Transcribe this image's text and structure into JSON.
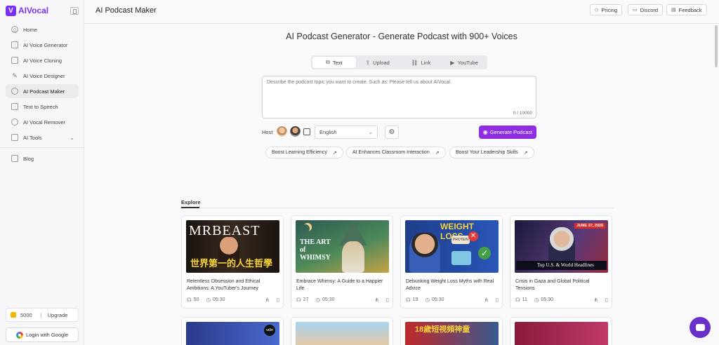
{
  "brand": {
    "name": "AIVocal",
    "logo_letter": "V"
  },
  "sidebar": {
    "items": [
      {
        "label": "Home",
        "icon": "home-icon"
      },
      {
        "label": "AI Voice Generator",
        "icon": "document-icon"
      },
      {
        "label": "AI Voice Cloning",
        "icon": "document-edit-icon"
      },
      {
        "label": "AI Voice Designer",
        "icon": "magic-wand-icon"
      },
      {
        "label": "AI Podcast Maker",
        "icon": "podcast-icon"
      },
      {
        "label": "Text to Speech",
        "icon": "text-icon"
      },
      {
        "label": "AI Vocal Remover",
        "icon": "vocal-remover-icon"
      },
      {
        "label": "AI Tools",
        "icon": "tools-icon"
      }
    ],
    "blog": "Blog",
    "credits": "5000",
    "upgrade": "Upgrade",
    "google_login": "Login with Google"
  },
  "header": {
    "title": "AI Podcast Maker",
    "pricing": "Pricing",
    "discord": "Discord",
    "feedback": "Feedback"
  },
  "main": {
    "title": "AI Podcast Generator - Generate Podcast with 900+ Voices",
    "tabs": [
      {
        "label": "Text",
        "icon": "text-tab-icon"
      },
      {
        "label": "Upload",
        "icon": "upload-icon"
      },
      {
        "label": "Link",
        "icon": "link-icon"
      },
      {
        "label": "YouTube",
        "icon": "youtube-icon"
      }
    ],
    "prompt_placeholder": "Describe the podcast topic you want to create. Such as: Please tell us about AIVocal.",
    "counter": "0 / 10000",
    "host_label": "Host",
    "language": "English",
    "generate": "Generate Podcast",
    "suggestions": [
      "Boost Learning Efficiency",
      "AI Enhances Classroom Interaction",
      "Boost Your Leadership Skills"
    ],
    "explore": "Explore"
  },
  "cards": [
    {
      "title": "Relentless Obsession and Ethical Ambitions: A YouTuber's Journey",
      "listens": "50",
      "duration": "05:30",
      "thumb_text": "MRBEAST",
      "thumb_sub": "世界第一的人生哲學"
    },
    {
      "title": "Embrace Whimsy: A Guide to a Happier Life",
      "listens": "27",
      "duration": "05:30",
      "thumb_text": "THE ART of WHIMSY",
      "thumb_sub": ""
    },
    {
      "title": "Debunking Weight Loss Myths with Real Advice",
      "listens": "19",
      "duration": "05:30",
      "thumb_text": "WEIGHT LOSS",
      "thumb_sub": "PROTEIN"
    },
    {
      "title": "Crisis in Gaza and Global Political Tensions",
      "listens": "11",
      "duration": "05:30",
      "thumb_text": "Top U.S. & World Headlines",
      "thumb_sub": "JUNE 27, 2025"
    }
  ],
  "cards_row2": [
    {
      "thumb_text": "udio"
    },
    {
      "thumb_text": ""
    },
    {
      "thumb_text": "18歲短視頻神童"
    },
    {
      "thumb_text": ""
    }
  ],
  "colors": {
    "accent": "#8e2de2",
    "brand": "#7b2ff7"
  }
}
